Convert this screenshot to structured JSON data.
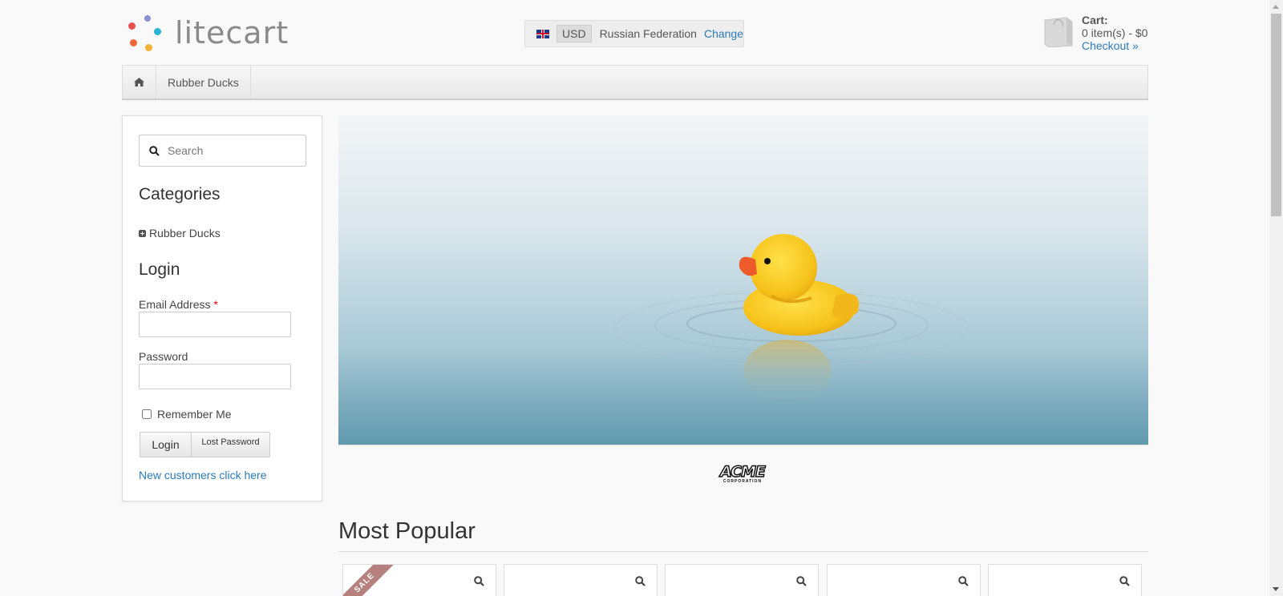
{
  "header": {
    "logo_text": "litecart",
    "region": {
      "currency": "USD",
      "country": "Russian Federation",
      "change_label": "Change"
    },
    "cart": {
      "title": "Cart:",
      "summary": "0 item(s) - $0",
      "checkout_label": "Checkout »"
    }
  },
  "nav": {
    "items": [
      {
        "label": "Rubber Ducks"
      }
    ]
  },
  "sidebar": {
    "search_placeholder": "Search",
    "categories_heading": "Categories",
    "categories": [
      {
        "label": "Rubber Ducks"
      }
    ],
    "login_heading": "Login",
    "email_label": "Email Address",
    "required_mark": "*",
    "password_label": "Password",
    "remember_label": "Remember Me",
    "login_button": "Login",
    "lost_password_button": "Lost Password",
    "new_customers_link": "New customers click here"
  },
  "manufacturer": {
    "name": "ACME",
    "sub": "CORPORATION"
  },
  "most_popular": {
    "title": "Most Popular",
    "sale_label": "SALE"
  },
  "colors": {
    "link": "#2a7ab8",
    "sale_ribbon": "#b5807e",
    "logo_dots": [
      "#e94f4f",
      "#7a7fd1",
      "#2bb3d4",
      "#f2b233",
      "#f0683a"
    ]
  }
}
